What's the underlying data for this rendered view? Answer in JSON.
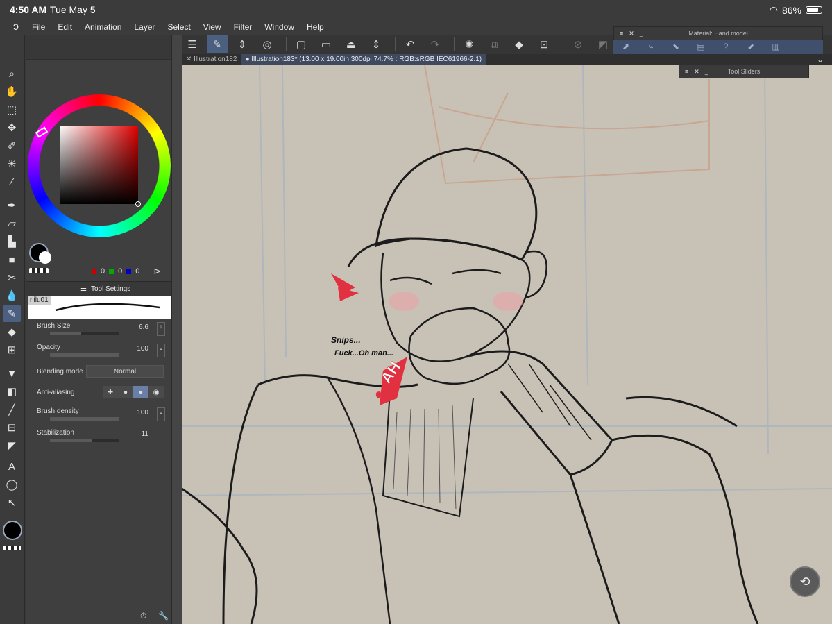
{
  "status": {
    "time": "4:50 AM",
    "date": "Tue May 5",
    "battery": "86%",
    "battery_level": 0.86
  },
  "menu": {
    "items": [
      "File",
      "Edit",
      "Animation",
      "Layer",
      "Select",
      "View",
      "Filter",
      "Window",
      "Help"
    ]
  },
  "tabs": [
    {
      "label": "Illustration182"
    },
    {
      "label": "Illustration183* (13.00 x 19.00in 300dpi 74.7% : RGB:sRGB IEC61966-2.1)"
    }
  ],
  "palettes": {
    "material_title": "Material: Hand model",
    "sliders_title": "Tool Sliders"
  },
  "color": {
    "main": "#000000",
    "sub": "#ffffff",
    "r": "0",
    "g": "0",
    "b": "0",
    "hue_color": "#e00000"
  },
  "tool_settings": {
    "title": "Tool Settings",
    "brush_name": "riilu01",
    "props": [
      {
        "label": "Brush Size",
        "value": "6.6",
        "level": 0.45
      },
      {
        "label": "Opacity",
        "value": "100",
        "level": 1.0
      },
      {
        "label": "Blending mode",
        "value": "Normal"
      },
      {
        "label": "Anti-aliasing"
      },
      {
        "label": "Brush density",
        "value": "100",
        "level": 1.0
      },
      {
        "label": "Stabilization",
        "value": "11",
        "level": 0.6
      }
    ]
  },
  "canvas_text": {
    "line1": "Snips...",
    "line2": "Fuck...Oh man...",
    "ah": "AH"
  },
  "colors": {
    "accent": "#4b5f80",
    "canvas": "#c8c1b6",
    "blush": "#e1303f"
  }
}
